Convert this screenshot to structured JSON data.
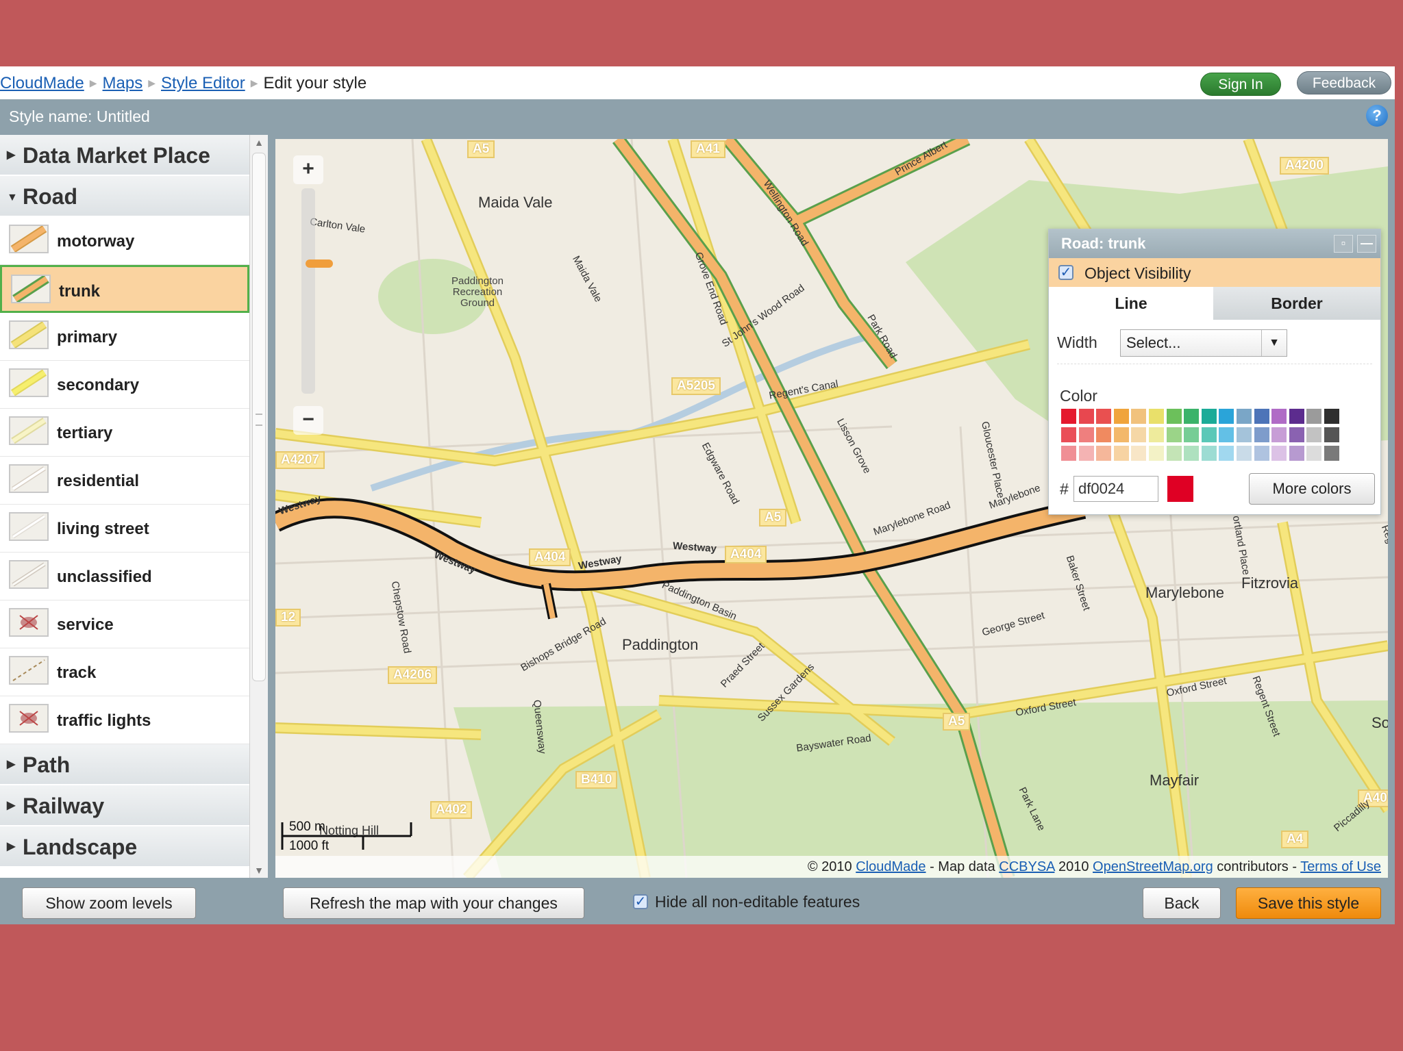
{
  "breadcrumb": {
    "items": [
      "CloudMade",
      "Maps",
      "Style Editor"
    ],
    "current": "Edit your style"
  },
  "header": {
    "sign_in": "Sign In",
    "feedback": "Feedback"
  },
  "style_bar": {
    "style_name": "Style name: Untitled",
    "help_icon": "?"
  },
  "sidebar": {
    "categories_top": [
      {
        "label": "Data Market Place",
        "expanded": false
      }
    ],
    "road": {
      "label": "Road",
      "expanded": true,
      "items": [
        {
          "label": "motorway",
          "icon": "motorway-swatch"
        },
        {
          "label": "trunk",
          "icon": "trunk-swatch",
          "selected": true
        },
        {
          "label": "primary",
          "icon": "primary-swatch"
        },
        {
          "label": "secondary",
          "icon": "secondary-swatch"
        },
        {
          "label": "tertiary",
          "icon": "tertiary-swatch"
        },
        {
          "label": "residential",
          "icon": "residential-swatch"
        },
        {
          "label": "living street",
          "icon": "living-street-swatch"
        },
        {
          "label": "unclassified",
          "icon": "unclassified-swatch"
        },
        {
          "label": "service",
          "icon": "service-swatch"
        },
        {
          "label": "track",
          "icon": "track-swatch"
        },
        {
          "label": "traffic lights",
          "icon": "traffic-lights-swatch"
        }
      ]
    },
    "categories_bottom": [
      {
        "label": "Path",
        "expanded": false
      },
      {
        "label": "Railway",
        "expanded": false
      },
      {
        "label": "Landscape",
        "expanded": false
      }
    ]
  },
  "map": {
    "zoom_in": "+",
    "zoom_out": "−",
    "scale": {
      "metric": "500 m",
      "imperial": "1000 ft"
    },
    "road_labels": [
      "A5",
      "A41",
      "A4200",
      "A5205",
      "A4207",
      "A404",
      "A404",
      "A5",
      "A4206",
      "B410",
      "A402",
      "A5",
      "A4",
      "A40",
      "12"
    ],
    "places": [
      "Maida Vale",
      "Paddington",
      "Marylebone",
      "Fitzrovia",
      "Mayfair",
      "Notting Hill",
      "Paddington Recreation Ground",
      "Soh"
    ],
    "streets": [
      "Carlton Vale",
      "Maida Vale",
      "Grove End Road",
      "Wellington Road",
      "Prince Albert",
      "St John's Wood Road",
      "Park Road",
      "Lisson Grove",
      "Edgware Road",
      "Westway",
      "Westway",
      "Westway",
      "Westway",
      "Marylebone Road",
      "Bishops Bridge Road",
      "Praed Street",
      "Sussex Gardens",
      "Bayswater Road",
      "Oxford Street",
      "Oxford Street",
      "George Street",
      "Baker Street",
      "Regent Street",
      "Park Lane",
      "Piccadilly",
      "Chepstow Road",
      "Queensway",
      "Gloucester Place",
      "Marylebone",
      "Regent's Canal",
      "Paddington Basin",
      "Portland Place",
      "Regent's Park"
    ],
    "attribution": {
      "prefix": "© 2010",
      "cloudmade": "CloudMade",
      "mid1": "- Map data",
      "ccbysa": "CCBYSA",
      "mid2": "2010",
      "osm": "OpenStreetMap.org",
      "mid3": "contributors -",
      "terms": "Terms of Use"
    }
  },
  "style_panel": {
    "title": "Road: trunk",
    "visibility_label": "Object Visibility",
    "visibility_checked": true,
    "tabs": [
      "Line",
      "Border"
    ],
    "active_tab": "Line",
    "width_label": "Width",
    "width_value": "Select...",
    "color_label": "Color",
    "hash": "#",
    "hex_value": "df0024",
    "swatch_color": "#df0024",
    "more_colors": "More colors",
    "palette": [
      [
        "#e5192e",
        "#e8474f",
        "#e95050",
        "#f0a43c",
        "#f1c27d",
        "#e9e06a",
        "#6cc05b",
        "#3bb36a",
        "#1bab98",
        "#2aa4d9",
        "#7aa6c7",
        "#4d74b8",
        "#b06bc6",
        "#5c2c8e",
        "#9b9b9b",
        "#2e2e2e"
      ],
      [
        "#ea4e58",
        "#ef7f7e",
        "#f08a60",
        "#f3b86a",
        "#f5d7a6",
        "#eeeb9c",
        "#9bd488",
        "#76cd95",
        "#5bc8b8",
        "#63c0e6",
        "#a4c3da",
        "#7e9ccb",
        "#c79dd6",
        "#8a62b1",
        "#c2c2c2",
        "#555555"
      ],
      [
        "#f08f95",
        "#f4b3b3",
        "#f5b79a",
        "#f7d3a2",
        "#f8e6c7",
        "#f3f2c6",
        "#c4e4b6",
        "#aee1bf",
        "#9ddcd3",
        "#a1d8ef",
        "#c9dbe8",
        "#afc3e0",
        "#dcc2e6",
        "#b79ad0",
        "#dcdcdc",
        "#7a7a7a"
      ]
    ]
  },
  "bottom_bar": {
    "show_zoom_levels": "Show zoom levels",
    "refresh": "Refresh the map with your changes",
    "hide_label": "Hide all non-editable features",
    "hide_checked": true,
    "back": "Back",
    "save": "Save this style"
  },
  "colors": {
    "page_background": "#c0585a",
    "toolbar": "#8ea1ab",
    "selected_row": "#fad3a0",
    "selected_border": "#52b04a",
    "trunk_road": "#f4b46a",
    "primary_road": "#f5e27a",
    "save_button": "#ef8a0c",
    "sign_in": "#2b7a2e"
  }
}
